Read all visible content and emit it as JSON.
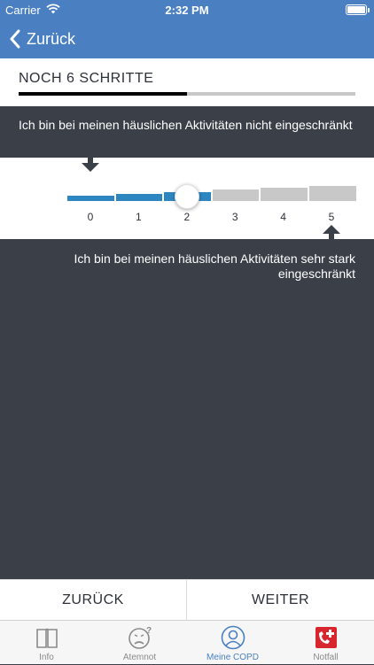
{
  "status_bar": {
    "carrier": "Carrier",
    "time": "2:32 PM"
  },
  "nav": {
    "back_label": "Zurück"
  },
  "progress": {
    "title": "NOCH 6 SCHRITTE",
    "fraction": 0.5
  },
  "question": {
    "min_label": "Ich bin bei meinen häuslichen Aktivitäten nicht eingeschränkt",
    "max_label": "Ich bin bei meinen häuslichen Aktivitäten sehr stark eingeschränkt"
  },
  "slider": {
    "ticks": [
      "0",
      "1",
      "2",
      "3",
      "4",
      "5"
    ],
    "selected_value": 2,
    "active_color": "#2e86c1",
    "inactive_color": "#c8c8c8"
  },
  "buttons": {
    "back": "ZURÜCK",
    "next": "WEITER"
  },
  "tabs": [
    {
      "label": "Info",
      "icon": "book-icon"
    },
    {
      "label": "Atemnot",
      "icon": "face-icon"
    },
    {
      "label": "Meine COPD",
      "icon": "user-icon",
      "active": true
    },
    {
      "label": "Notfall",
      "icon": "emergency-phone-icon"
    }
  ],
  "colors": {
    "brand": "#4a80c2",
    "background": "#3a3f48"
  }
}
